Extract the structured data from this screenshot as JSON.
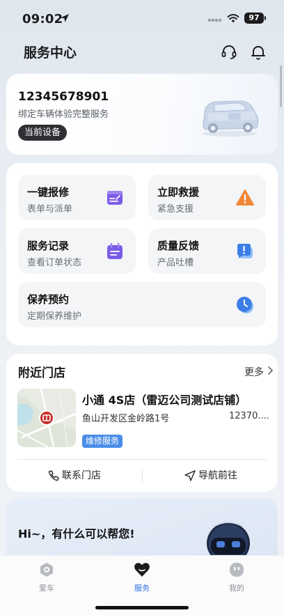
{
  "status_bar": {
    "time": "09:02",
    "battery": "97"
  },
  "header": {
    "title": "服务中心",
    "icons": [
      "headset-icon",
      "bell-icon"
    ]
  },
  "device": {
    "phone": "12345678901",
    "description": "绑定车辆体验完整服务",
    "badge": "当前设备"
  },
  "services": [
    {
      "title": "一键报修",
      "subtitle": "表单与派单",
      "icon": "repair-form-icon",
      "color": "#7b5ce6"
    },
    {
      "title": "立即救援",
      "subtitle": "紧急支援",
      "icon": "warning-icon",
      "color": "#f0883a"
    },
    {
      "title": "服务记录",
      "subtitle": "查看订单状态",
      "icon": "record-icon",
      "color": "#7b5ce6"
    },
    {
      "title": "质量反馈",
      "subtitle": "产品吐槽",
      "icon": "feedback-icon",
      "color": "#3b7ee6"
    },
    {
      "title": "保养预约",
      "subtitle": "定期保养维护",
      "icon": "clock-icon",
      "color": "#3b7ee6"
    }
  ],
  "nearby": {
    "title": "附近门店",
    "more": "更多",
    "store": {
      "name": "小通 4S店（雷迈公司测试店铺）",
      "address": "鱼山开发区金岭路1号",
      "phone": "12370....",
      "tag": "维修服务"
    },
    "actions": {
      "contact": "联系门店",
      "navigate": "导航前往"
    }
  },
  "assistant": {
    "greeting": "Hi~，有什么可以帮您!"
  },
  "tabs": [
    {
      "label": "爱车",
      "icon": "car-tab-icon"
    },
    {
      "label": "服务",
      "icon": "heart-tab-icon"
    },
    {
      "label": "我的",
      "icon": "profile-tab-icon"
    }
  ],
  "colors": {
    "accent": "#2f6fe0",
    "tag": "#4a8ee8",
    "badge": "#2d2f33"
  }
}
